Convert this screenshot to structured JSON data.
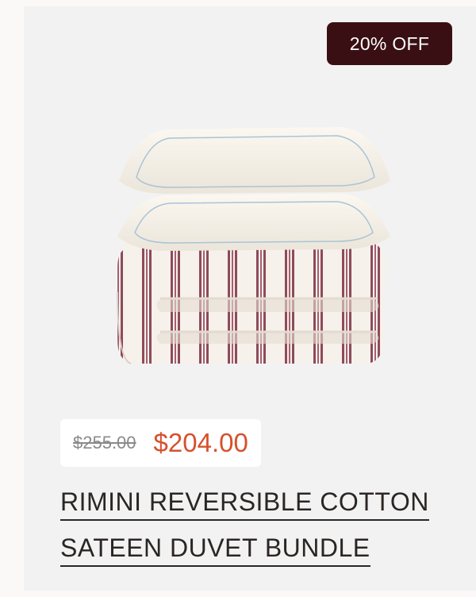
{
  "product": {
    "badge": "20% OFF",
    "original_price": "$255.00",
    "sale_price": "$204.00",
    "title_line1": "RIMINI REVERSIBLE COTTON",
    "title_line2": "SATEEN DUVET BUNDLE",
    "image_icon": "bedding-bundle-image"
  },
  "colors": {
    "badge_bg": "#3a0f13",
    "sale_price": "#d6512d",
    "stripe": "#8e4a5c"
  }
}
